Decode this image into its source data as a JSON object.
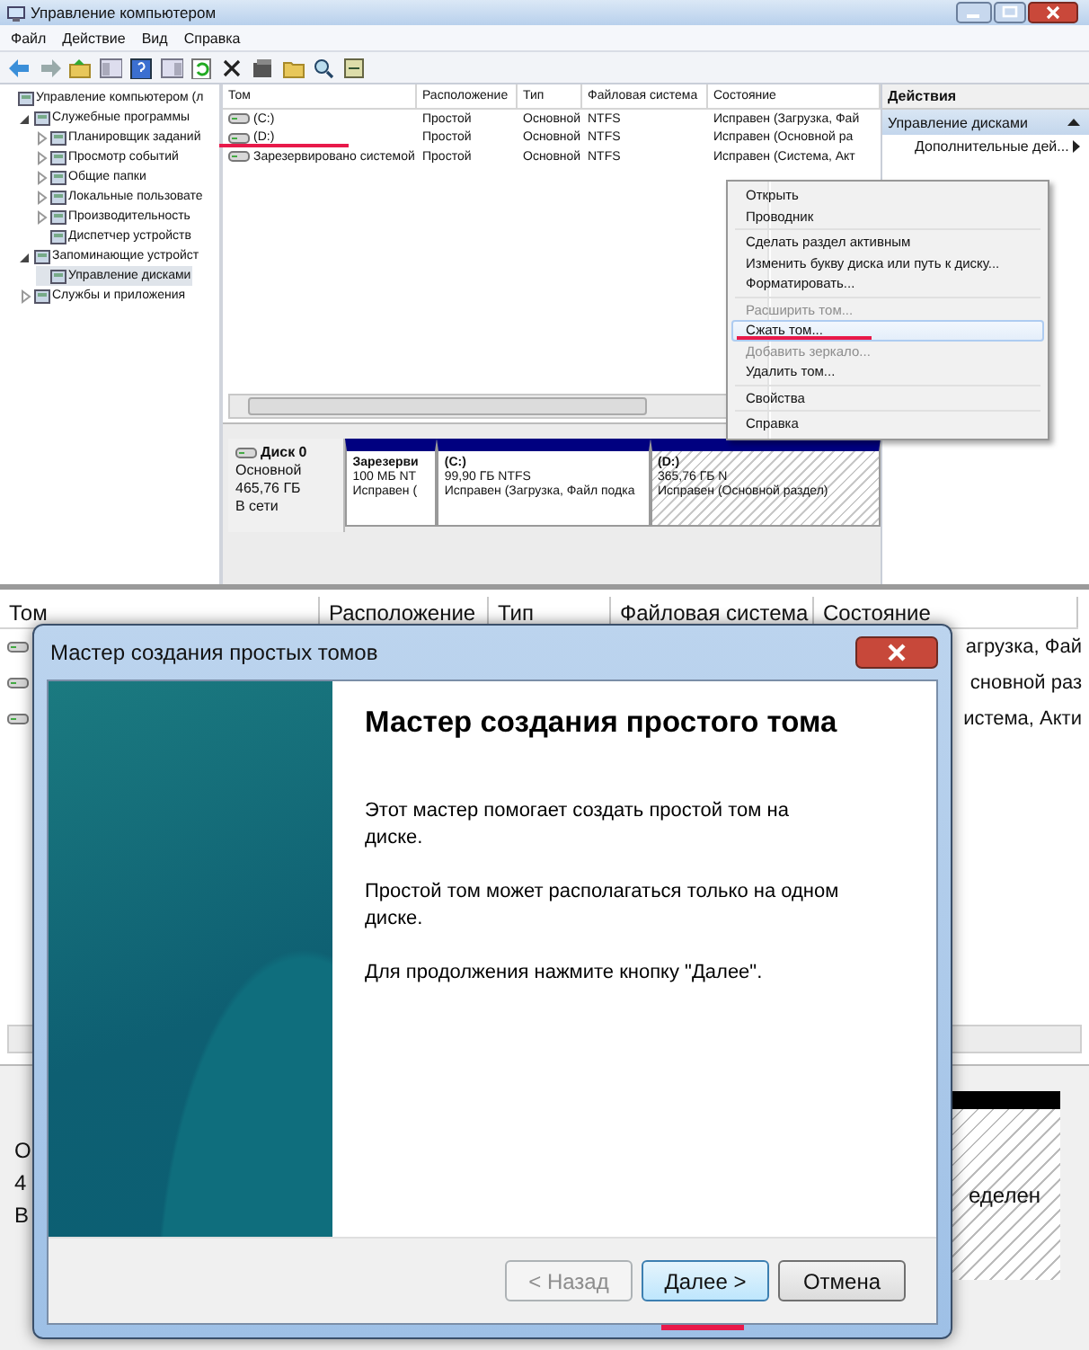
{
  "top_window": {
    "title": "Управление компьютером",
    "menu": [
      "Файл",
      "Действие",
      "Вид",
      "Справка"
    ],
    "tree": [
      {
        "label": "Управление компьютером (л",
        "selected": false,
        "children": [
          {
            "label": "Служебные программы",
            "expanded": true,
            "selected": false,
            "children": [
              {
                "label": "Планировщик заданий",
                "expanded": false,
                "selected": false
              },
              {
                "label": "Просмотр событий",
                "expanded": false,
                "selected": false
              },
              {
                "label": "Общие папки",
                "expanded": false,
                "selected": false
              },
              {
                "label": "Локальные пользовате",
                "expanded": false,
                "selected": false
              },
              {
                "label": "Производительность",
                "expanded": false,
                "selected": false
              },
              {
                "label": "Диспетчер устройств",
                "selected": false
              }
            ]
          },
          {
            "label": "Запоминающие устройст",
            "expanded": true,
            "selected": false,
            "children": [
              {
                "label": "Управление дисками",
                "selected": true
              }
            ]
          },
          {
            "label": "Службы и приложения",
            "expanded": false,
            "selected": false
          }
        ]
      }
    ],
    "volumes": {
      "columns": [
        "Том",
        "Расположение",
        "Тип",
        "Файловая система",
        "Состояние"
      ],
      "rows": [
        [
          "(C:)",
          "Простой",
          "Основной",
          "NTFS",
          "Исправен (Загрузка, Фай"
        ],
        [
          "(D:)",
          "Простой",
          "Основной",
          "NTFS",
          "Исправен (Основной ра"
        ],
        [
          "Зарезервировано системой",
          "Простой",
          "Основной",
          "NTFS",
          "Исправен (Система, Акт"
        ]
      ]
    },
    "disk": {
      "name": "Диск 0",
      "type": "Основной",
      "size": "465,76 ГБ",
      "status": "В сети",
      "partitions": [
        {
          "name": "Зарезерви",
          "size": "100 МБ NT",
          "status": "Исправен (",
          "hatched": false
        },
        {
          "name": "(C:)",
          "size": "99,90 ГБ NTFS",
          "status": "Исправен (Загрузка, Файл подка",
          "hatched": false
        },
        {
          "name": "(D:)",
          "size": "365,76 ГБ N",
          "status": "Исправен (Основной раздел)",
          "hatched": true
        }
      ]
    },
    "actions": {
      "title": "Действия",
      "section": "Управление дисками",
      "items": [
        "Дополнительные дей..."
      ]
    },
    "context_menu": [
      {
        "kind": "item",
        "label": "Открыть",
        "disabled": false,
        "selected": false
      },
      {
        "kind": "item",
        "label": "Проводник",
        "disabled": false,
        "selected": false
      },
      {
        "kind": "separator"
      },
      {
        "kind": "item",
        "label": "Сделать раздел активным",
        "disabled": false,
        "selected": false
      },
      {
        "kind": "item",
        "label": "Изменить букву диска или путь к диску...",
        "disabled": false,
        "selected": false
      },
      {
        "kind": "item",
        "label": "Форматировать...",
        "disabled": false,
        "selected": false
      },
      {
        "kind": "separator"
      },
      {
        "kind": "item",
        "label": "Расширить том...",
        "disabled": true,
        "selected": false
      },
      {
        "kind": "item",
        "label": "Сжать том...",
        "disabled": false,
        "selected": true
      },
      {
        "kind": "item",
        "label": "Добавить зеркало...",
        "disabled": true,
        "selected": false
      },
      {
        "kind": "item",
        "label": "Удалить том...",
        "disabled": false,
        "selected": false
      },
      {
        "kind": "separator"
      },
      {
        "kind": "item",
        "label": "Свойства",
        "disabled": false,
        "selected": false
      },
      {
        "kind": "separator"
      },
      {
        "kind": "item",
        "label": "Справка",
        "disabled": false,
        "selected": false
      }
    ]
  },
  "bottom_window": {
    "columns": [
      "Том",
      "Расположение",
      "Тип",
      "Файловая система",
      "Состояние"
    ],
    "rows": [
      {
        "status": "агрузка, Фай"
      },
      {
        "status": "сновной раз"
      },
      {
        "status": "истема, Акти"
      }
    ],
    "disk": {
      "lines": [
        "О",
        "4",
        "В"
      ],
      "status": "еделен"
    },
    "dialog": {
      "title": "Мастер создания простых томов",
      "heading": "Мастер создания простого тома",
      "paragraphs": [
        "Этот мастер помогает создать простой том на диске.",
        "Простой том может располагаться только на одном диске.",
        "Для продолжения нажмите кнопку \"Далее\"."
      ],
      "buttons": [
        {
          "label": "< Назад",
          "disabled": true,
          "default": false
        },
        {
          "label": "Далее >",
          "disabled": false,
          "default": true
        },
        {
          "label": "Отмена",
          "disabled": false,
          "default": false
        }
      ]
    }
  }
}
